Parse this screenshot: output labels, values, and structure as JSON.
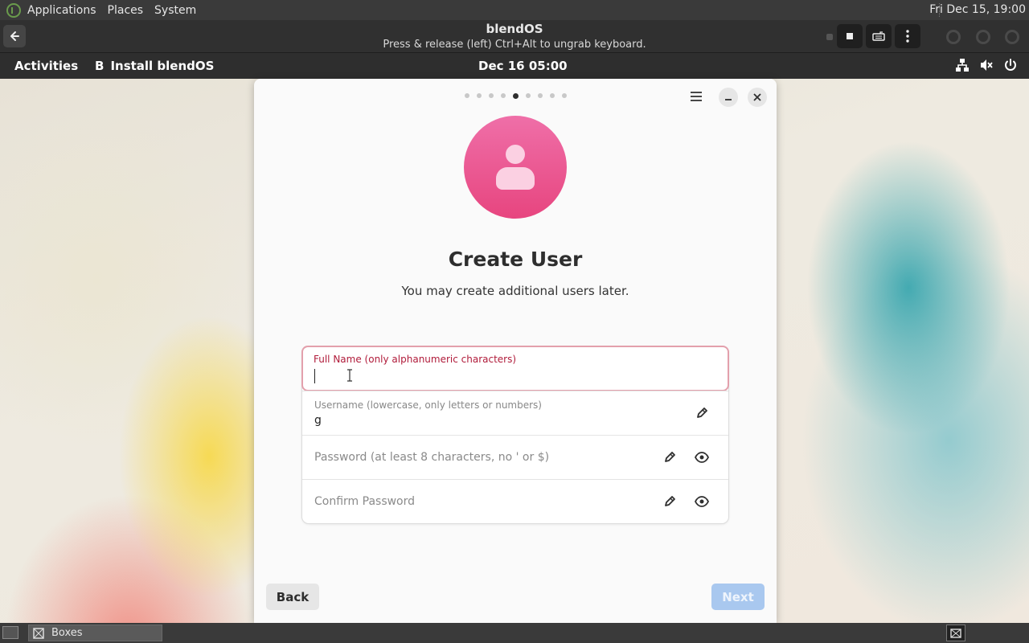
{
  "host_panel": {
    "menus": [
      "Applications",
      "Places",
      "System"
    ],
    "clock": "Fri Dec 15, 19:00"
  },
  "boxes_header": {
    "title": "blendOS",
    "subtitle": "Press & release (left) Ctrl+Alt to ungrab keyboard."
  },
  "gnome_bar": {
    "activities": "Activities",
    "app_icon": "B",
    "app_name": "Install blendOS",
    "datetime": "Dec 16  05:00"
  },
  "installer": {
    "step_dots": {
      "total": 9,
      "active_index": 4
    },
    "title": "Create User",
    "subtitle": "You may create additional users later.",
    "fields": {
      "full_name": {
        "label": "Full Name (only alphanumeric characters)",
        "value": ""
      },
      "username": {
        "label": "Username (lowercase, only letters or numbers)",
        "value": "g"
      },
      "password": {
        "placeholder": "Password (at least 8 characters, no ' or $)"
      },
      "confirm_password": {
        "placeholder": "Confirm Password"
      }
    },
    "back_label": "Back",
    "next_label": "Next"
  },
  "taskbar": {
    "task_label": "Boxes"
  },
  "colors": {
    "avatar_gradient_top": "#ef6fa8",
    "avatar_gradient_bottom": "#e7457f",
    "focus_border": "#e3a0ac",
    "focus_label": "#b01b3a",
    "next_disabled": "#a9c8ef"
  }
}
